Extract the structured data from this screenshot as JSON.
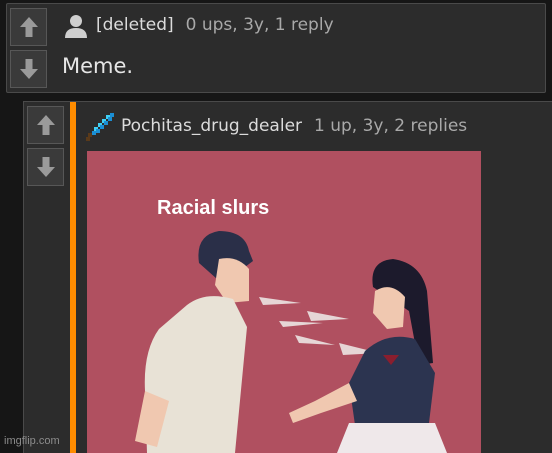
{
  "comments": [
    {
      "username": "[deleted]",
      "stats": "0 ups, 3y, 1 reply",
      "text": "Meme.",
      "avatar_icon": "user-silhouette-icon"
    },
    {
      "username": "Pochitas_drug_dealer",
      "stats": "1 up, 3y, 2 replies",
      "avatar_icon": "diamond-sword-icon",
      "accent_color": "#ff8c00",
      "image": {
        "caption": "Racial slurs",
        "background_color": "#b05060"
      }
    }
  ],
  "vote_icons": [
    "upvote-arrow-icon",
    "downvote-arrow-icon"
  ],
  "watermark": "imgflip.com"
}
